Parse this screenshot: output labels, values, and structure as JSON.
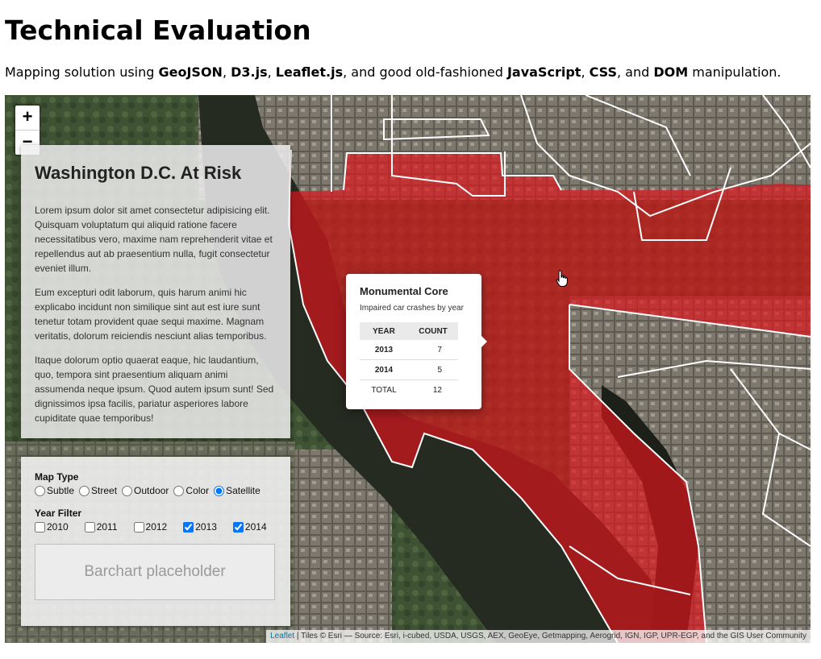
{
  "page": {
    "title": "Technical Evaluation",
    "subtitle": {
      "t1": "Mapping solution using ",
      "b1": "GeoJSON",
      "t2": ", ",
      "b2": "D3.js",
      "t3": ", ",
      "b3": "Leaflet.js",
      "t4": ", and good old-fashioned ",
      "b4": "JavaScript",
      "t5": ", ",
      "b5": "CSS",
      "t6": ", and ",
      "b6": "DOM",
      "t7": " manipulation."
    }
  },
  "zoom": {
    "in": "+",
    "out": "−"
  },
  "info_panel": {
    "title": "Washington D.C. At Risk",
    "paragraphs": [
      "Lorem ipsum dolor sit amet consectetur adipisicing elit. Quisquam voluptatum qui aliquid ratione facere necessitatibus vero, maxime nam reprehenderit vitae et repellendus aut ab praesentium nulla, fugit consectetur eveniet illum.",
      "Eum excepturi odit laborum, quis harum animi hic explicabo incidunt non similique sint aut est iure sunt tenetur totam provident quae sequi maxime. Magnam veritatis, dolorum reiciendis nesciunt alias temporibus.",
      "Itaque dolorum optio quaerat eaque, hic laudantium, quo, tempora sint praesentium aliquam animi assumenda neque ipsum. Quod autem ipsum sunt! Sed dignissimos ipsa facilis, pariatur asperiores labore cupiditate quae temporibus!"
    ]
  },
  "controls": {
    "map_type_label": "Map Type",
    "map_types": [
      {
        "label": "Subtle",
        "checked": false
      },
      {
        "label": "Street",
        "checked": false
      },
      {
        "label": "Outdoor",
        "checked": false
      },
      {
        "label": "Color",
        "checked": false
      },
      {
        "label": "Satellite",
        "checked": true
      }
    ],
    "year_filter_label": "Year Filter",
    "years": [
      {
        "label": "2010",
        "checked": false
      },
      {
        "label": "2011",
        "checked": false
      },
      {
        "label": "2012",
        "checked": false
      },
      {
        "label": "2013",
        "checked": true
      },
      {
        "label": "2014",
        "checked": true
      }
    ],
    "barchart_placeholder": "Barchart placeholder"
  },
  "popup": {
    "title": "Monumental Core",
    "subtitle": "Impaired car crashes by year",
    "headers": [
      "YEAR",
      "COUNT"
    ],
    "rows": [
      {
        "year": "2013",
        "count": "7"
      },
      {
        "year": "2014",
        "count": "5"
      }
    ],
    "total_label": "TOTAL",
    "total_count": "12"
  },
  "attribution": {
    "link": "Leaflet",
    "text": " | Tiles © Esri — Source: Esri, i-cubed, USDA, USGS, AEX, GeoEye, Getmapping, Aerogrid, IGN, IGP, UPR-EGP, and the GIS User Community"
  },
  "colors": {
    "highlight": "#e0141c",
    "boundary": "#ffffff",
    "water": "#262b22",
    "link": "#0078a8"
  },
  "icons": {
    "cursor": "hand-pointer-icon"
  }
}
